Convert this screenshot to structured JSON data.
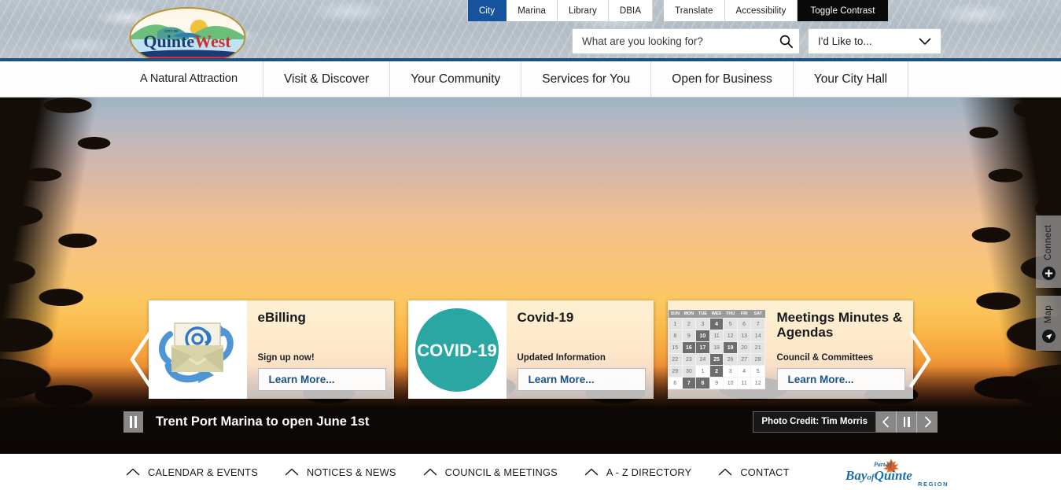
{
  "header": {
    "utility_tabs": [
      {
        "label": "City",
        "state": "active"
      },
      {
        "label": "Marina",
        "state": "normal"
      },
      {
        "label": "Library",
        "state": "normal"
      },
      {
        "label": "DBIA",
        "state": "normal"
      }
    ],
    "utility_tools": [
      {
        "label": "Translate",
        "state": "normal"
      },
      {
        "label": "Accessibility",
        "state": "normal"
      },
      {
        "label": "Toggle Contrast",
        "state": "dark"
      }
    ],
    "search": {
      "placeholder": "What are you looking for?",
      "value": "",
      "icon": "search-icon"
    },
    "ilike_to": {
      "label": "I'd Like to...",
      "icon": "chevron-down-icon"
    },
    "logo": {
      "name_part1": "Quinte",
      "name_part2": "West",
      "small_top": "CITY OF",
      "tagline": "A Natural Attraction"
    },
    "accent_color": "#15539e",
    "navbar_border_color": "#1c4f82"
  },
  "mainnav": {
    "items": [
      {
        "label": "Visit & Discover"
      },
      {
        "label": "Your Community"
      },
      {
        "label": "Services for You"
      },
      {
        "label": "Open for Business"
      },
      {
        "label": "Your City Hall"
      }
    ]
  },
  "hero": {
    "prev_arrow_icon": "chevron-left-icon",
    "next_arrow_icon": "chevron-right-icon",
    "caption": {
      "pause_icon": "pause-icon",
      "title": "Trent Port Marina to open June 1st",
      "photo_credit": "Photo Credit: Tim Morris",
      "prev_icon": "chevron-left-icon",
      "pause_icon2": "pause-icon",
      "next_icon": "chevron-right-icon"
    },
    "cards": [
      {
        "id": "ebilling",
        "image_icon": "email-envelope-icon",
        "title": "eBilling",
        "subtitle": "Sign up now!",
        "button": "Learn More..."
      },
      {
        "id": "covid19",
        "image_icon": "covid-badge-icon",
        "image_text": "COVID-19",
        "image_color": "#27a9a6",
        "title": "Covid-19",
        "subtitle": "Updated Information",
        "button": "Learn More..."
      },
      {
        "id": "meetings",
        "image_icon": "calendar-icon",
        "title": "Meetings Minutes & Agendas",
        "subtitle": "Council & Committees",
        "button": "Learn More..."
      }
    ],
    "calendar": {
      "weekdays": [
        "SUN",
        "MON",
        "TUE",
        "WED",
        "THU",
        "FRI",
        "SAT"
      ],
      "weeks": [
        [
          {
            "d": "1",
            "hl": false
          },
          {
            "d": "2",
            "hl": false
          },
          {
            "d": "3",
            "hl": false
          },
          {
            "d": "4",
            "hl": true
          },
          {
            "d": "5",
            "hl": false
          },
          {
            "d": "6",
            "hl": false
          },
          {
            "d": "7",
            "hl": false
          }
        ],
        [
          {
            "d": "8",
            "hl": false
          },
          {
            "d": "9",
            "hl": false
          },
          {
            "d": "10",
            "hl": true
          },
          {
            "d": "11",
            "hl": false
          },
          {
            "d": "12",
            "hl": false
          },
          {
            "d": "13",
            "hl": false
          },
          {
            "d": "14",
            "hl": false
          }
        ],
        [
          {
            "d": "15",
            "hl": false
          },
          {
            "d": "16",
            "hl": true
          },
          {
            "d": "17",
            "hl": true
          },
          {
            "d": "18",
            "hl": false
          },
          {
            "d": "19",
            "hl": true
          },
          {
            "d": "20",
            "hl": false
          },
          {
            "d": "21",
            "hl": false
          }
        ],
        [
          {
            "d": "22",
            "hl": false
          },
          {
            "d": "23",
            "hl": false
          },
          {
            "d": "24",
            "hl": false
          },
          {
            "d": "25",
            "hl": true
          },
          {
            "d": "26",
            "hl": false
          },
          {
            "d": "27",
            "hl": false
          },
          {
            "d": "28",
            "hl": false
          }
        ],
        [
          {
            "d": "29",
            "hl": false
          },
          {
            "d": "30",
            "hl": false
          },
          {
            "d": "1",
            "hl": false,
            "out": true
          },
          {
            "d": "2",
            "hl": true
          },
          {
            "d": "3",
            "hl": false,
            "out": true
          },
          {
            "d": "4",
            "hl": false,
            "out": true
          },
          {
            "d": "5",
            "hl": false,
            "out": true
          }
        ],
        [
          {
            "d": "6",
            "hl": false,
            "out": true
          },
          {
            "d": "7",
            "hl": true
          },
          {
            "d": "8",
            "hl": true
          },
          {
            "d": "9",
            "hl": false,
            "out": true
          },
          {
            "d": "10",
            "hl": false,
            "out": true
          },
          {
            "d": "11",
            "hl": false,
            "out": true
          },
          {
            "d": "12",
            "hl": false,
            "out": true
          }
        ]
      ]
    },
    "side_tabs": [
      {
        "label": "Connect",
        "icon": "plus-circle-icon"
      },
      {
        "label": "Map",
        "icon": "map-pin-icon"
      }
    ]
  },
  "footer": {
    "links": [
      {
        "label": "CALENDAR & EVENTS",
        "icon": "chevron-up-icon"
      },
      {
        "label": "NOTICES & NEWS",
        "icon": "chevron-up-icon"
      },
      {
        "label": "COUNCIL & MEETINGS",
        "icon": "chevron-up-icon"
      },
      {
        "label": "A - Z DIRECTORY",
        "icon": "chevron-up-icon"
      },
      {
        "label": "CONTACT",
        "icon": "chevron-up-icon"
      }
    ],
    "partner_logo": {
      "line1": "Part of",
      "line2": "Bay of Quinte",
      "line3": "REGION",
      "icon": "maple-leaf-icon"
    }
  }
}
